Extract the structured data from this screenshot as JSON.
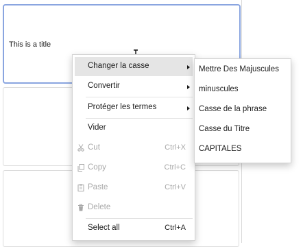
{
  "card": {
    "title": "This is a title"
  },
  "context_menu": {
    "change_case": "Changer la casse",
    "convert": "Convertir",
    "protect_terms": "Protéger les termes",
    "empty": "Vider",
    "cut": {
      "label": "Cut",
      "shortcut": "Ctrl+X",
      "enabled": false
    },
    "copy": {
      "label": "Copy",
      "shortcut": "Ctrl+C",
      "enabled": false
    },
    "paste": {
      "label": "Paste",
      "shortcut": "Ctrl+V",
      "enabled": false
    },
    "delete": {
      "label": "Delete",
      "enabled": false
    },
    "select_all": {
      "label": "Select all",
      "shortcut": "Ctrl+A",
      "enabled": true
    }
  },
  "case_submenu": {
    "items": [
      "Mettre Des Majuscules",
      "minuscules",
      "Casse de la phrase",
      "Casse du Titre",
      "CAPITALES"
    ]
  },
  "colors": {
    "hover": "#e5e5e5",
    "selected_border": "#8aa5e0",
    "disabled_text": "#a8a8a8"
  }
}
